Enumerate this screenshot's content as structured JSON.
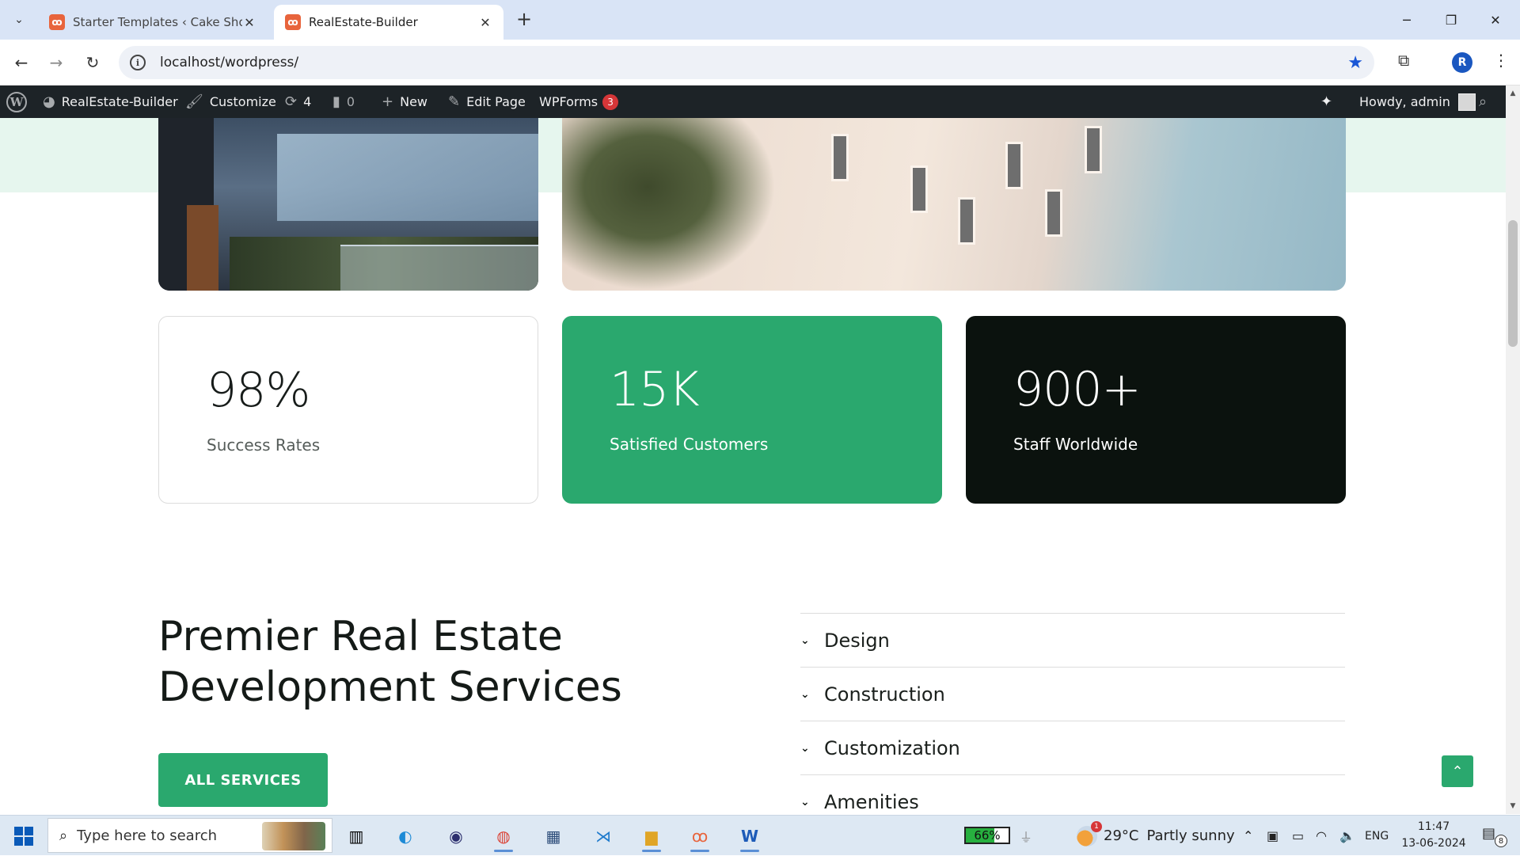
{
  "browser": {
    "tabs": [
      {
        "title": "Starter Templates ‹ Cake Shop –",
        "active": false
      },
      {
        "title": "RealEstate-Builder",
        "active": true
      }
    ],
    "url": "localhost/wordpress/",
    "profile_initial": "R"
  },
  "adminbar": {
    "site_name": "RealEstate-Builder",
    "customize": "Customize",
    "updates_count": "4",
    "comments_count": "0",
    "new_label": "New",
    "edit_page": "Edit Page",
    "wpforms": "WPForms",
    "wpforms_badge": "3",
    "howdy": "Howdy, admin"
  },
  "stats": [
    {
      "value": "98%",
      "label": "Success Rates"
    },
    {
      "value": "15K",
      "label": "Satisfied Customers"
    },
    {
      "value": "900+",
      "label": "Staff Worldwide"
    }
  ],
  "services": {
    "title_line1": "Premier Real Estate",
    "title_line2": "Development Services",
    "cta": "ALL SERVICES",
    "accordion": [
      "Design",
      "Construction",
      "Customization",
      "Amenities"
    ]
  },
  "taskbar": {
    "search_placeholder": "Type here to search",
    "battery": "66%",
    "battery_level": 0.66,
    "weather_temp": "29°C",
    "weather_text": "Partly sunny",
    "weather_badge": "1",
    "language": "ENG",
    "time": "11:47",
    "date": "13-06-2024",
    "notifications": "8"
  },
  "colors": {
    "accent_green": "#2aa86e",
    "dark_card": "#0b120e",
    "admin_bar": "#1d2327",
    "mint_band": "#e6f6ee"
  }
}
